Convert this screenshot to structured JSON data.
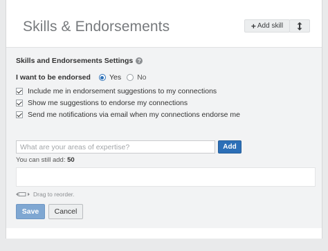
{
  "header": {
    "title": "Skills & Endorsements",
    "add_skill_label": "Add skill",
    "add_skill_icon": "plus-icon",
    "reorder_icon": "vertical-arrows-icon"
  },
  "settings": {
    "title": "Skills and Endorsements Settings",
    "help_icon": "?",
    "endorse_question": "I want to be endorsed",
    "options": [
      {
        "label": "Yes",
        "selected": true
      },
      {
        "label": "No",
        "selected": false
      }
    ],
    "checkboxes": [
      {
        "label": "Include me in endorsement suggestions to my connections",
        "checked": true
      },
      {
        "label": "Show me suggestions to endorse my connections",
        "checked": true
      },
      {
        "label": "Send me notifications via email when my connections endorse me",
        "checked": true
      }
    ]
  },
  "expertise": {
    "placeholder": "What are your areas of expertise?",
    "value": "",
    "add_label": "Add",
    "remaining_prefix": "You can still add:",
    "remaining_count": "50"
  },
  "reorder_hint": "Drag to reorder.",
  "actions": {
    "save_label": "Save",
    "cancel_label": "Cancel"
  },
  "colors": {
    "primary_blue": "#2c6fb7",
    "save_disabled_blue": "#7fa7d2",
    "panel_bg": "#f2f3f4"
  }
}
